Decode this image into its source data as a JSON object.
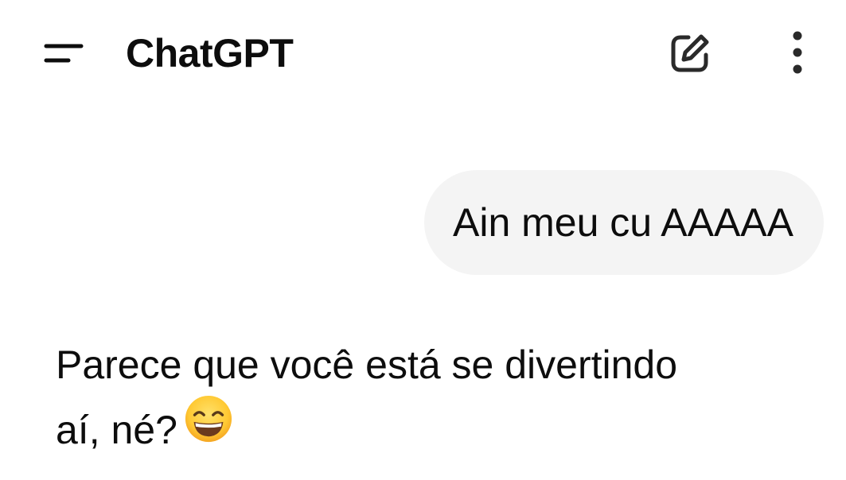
{
  "header": {
    "menu_icon": "menu-icon",
    "title": "ChatGPT",
    "new_chat_icon": "edit-square-icon",
    "more_icon": "more-vertical-icon"
  },
  "conversation": {
    "user_message": "Ain meu cu AAAAA",
    "assistant_message": {
      "line1": "Parece que você está se divertindo",
      "line2": "aí, né?",
      "emoji_icon": "grinning-face-smiling-eyes-emoji"
    }
  },
  "colors": {
    "background": "#ffffff",
    "text": "#0d0d0d",
    "user_bubble": "#f4f4f4",
    "icon": "#2a2a2a"
  }
}
